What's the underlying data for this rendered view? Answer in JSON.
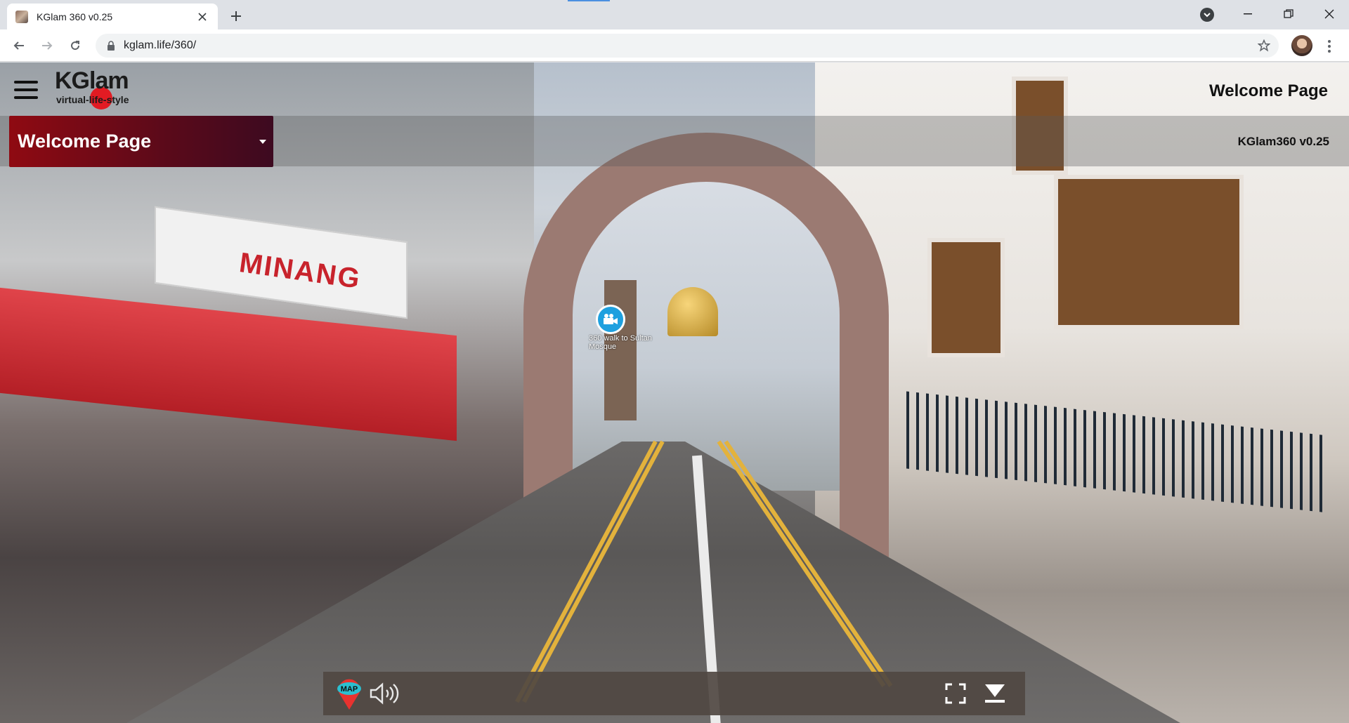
{
  "browser": {
    "tab_title": "KGlam 360 v0.25",
    "url": "kglam.life/360/"
  },
  "app": {
    "logo_main": "KGlam",
    "logo_sub": "virtual-life-style",
    "header_title": "Welcome Page",
    "version": "KGlam360 v0.25",
    "scene_dropdown_label": "Welcome Page"
  },
  "scene": {
    "shop_sign": "MINANG",
    "hotspot_label": "360 walk to Sultan Mosque"
  },
  "controls": {
    "map_label": "MAP"
  },
  "colors": {
    "dropdown_start": "#8f0a12",
    "dropdown_end": "#3d0a20",
    "hotspot": "#1ea0df",
    "controlbar": "#504842"
  }
}
